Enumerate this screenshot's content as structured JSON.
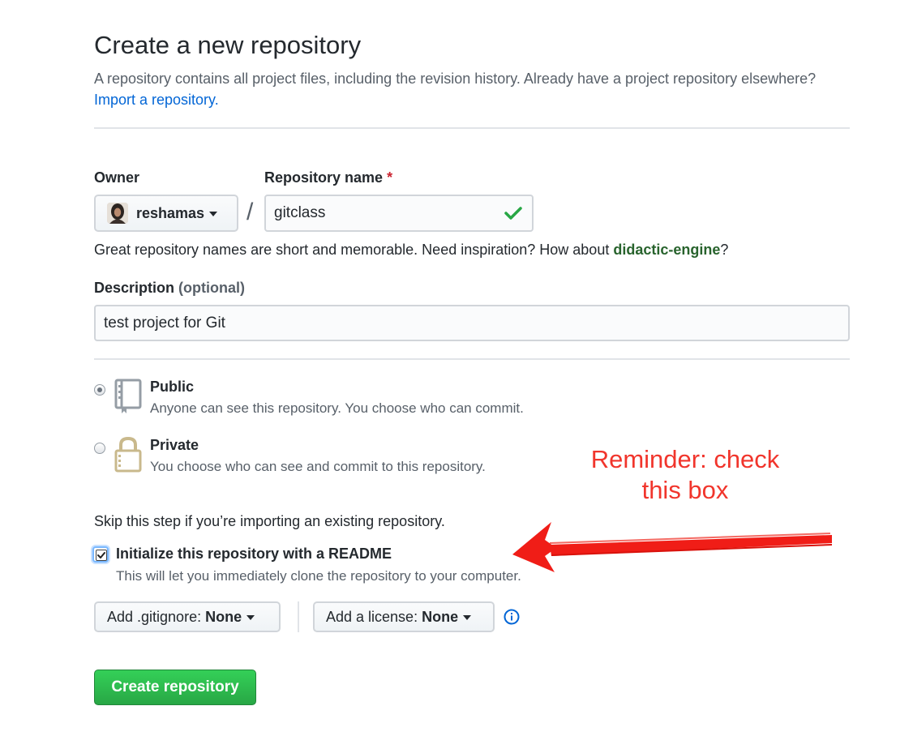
{
  "header": {
    "title": "Create a new repository",
    "subtitle": "A repository contains all project files, including the revision history. Already have a project repository elsewhere?",
    "import_link": "Import a repository."
  },
  "owner": {
    "label": "Owner",
    "value": "reshamas",
    "icon": "avatar"
  },
  "repo_name": {
    "label": "Repository name",
    "required_mark": "*",
    "value": "gitclass",
    "valid_icon": "check-icon",
    "valid_color": "#28a745"
  },
  "separator": "/",
  "name_hint": {
    "text": "Great repository names are short and memorable. Need inspiration? How about",
    "suggestion": "didactic-engine",
    "end": "?"
  },
  "description": {
    "label": "Description",
    "optional": "(optional)",
    "value": "test project for Git"
  },
  "visibility": {
    "selected": "public",
    "public": {
      "title": "Public",
      "desc": "Anyone can see this repository. You choose who can commit.",
      "icon": "repo-book-icon"
    },
    "private": {
      "title": "Private",
      "desc": "You choose who can see and commit to this repository.",
      "icon": "lock-icon"
    }
  },
  "init": {
    "skip_note": "Skip this step if you’re importing an existing repository.",
    "readme_label": "Initialize this repository with a README",
    "readme_desc": "This will let you immediately clone the repository to your computer.",
    "readme_checked": true
  },
  "gitignore": {
    "label": "Add .gitignore:",
    "value": "None"
  },
  "license": {
    "label": "Add a license:",
    "value": "None",
    "info_icon": "info-icon"
  },
  "submit": {
    "label": "Create repository",
    "color": "#28a745"
  },
  "annotation": {
    "line1": "Reminder:  check",
    "line2": "this box",
    "color": "#f1352c",
    "arrow": "red-arrow"
  }
}
